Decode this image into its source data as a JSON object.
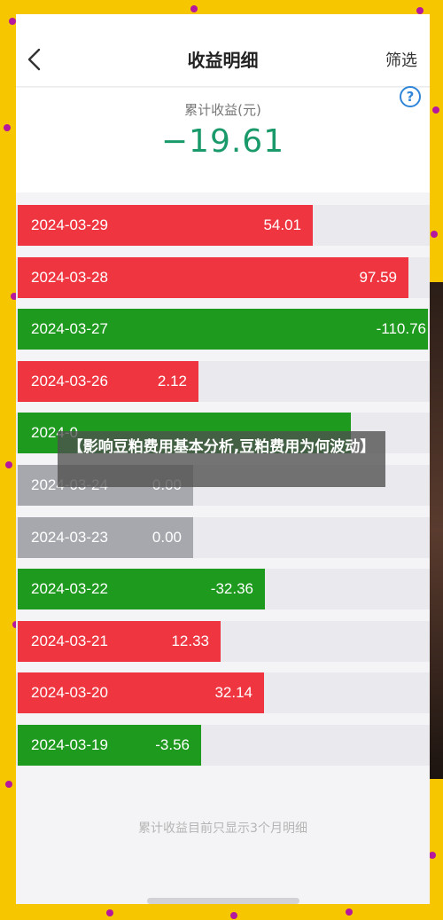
{
  "nav": {
    "title": "收益明细",
    "filter_label": "筛选"
  },
  "summary": {
    "label": "累计收益(元)",
    "value": "−19.61",
    "help_symbol": "?"
  },
  "colors": {
    "positive": "#ef3640",
    "negative": "#1e9a1e",
    "zero": "#a7a8ae",
    "summary_value": "#1a9a6a"
  },
  "rows": [
    {
      "date": "2024-03-29",
      "value": "54.01"
    },
    {
      "date": "2024-03-28",
      "value": "97.59"
    },
    {
      "date": "2024-03-27",
      "value": "-110.76"
    },
    {
      "date": "2024-03-26",
      "value": "2.12"
    },
    {
      "date": "2024-0",
      "value": ""
    },
    {
      "date": "2024-03-24",
      "value": "0.00"
    },
    {
      "date": "2024-03-23",
      "value": "0.00"
    },
    {
      "date": "2024-03-22",
      "value": "-32.36"
    },
    {
      "date": "2024-03-21",
      "value": "12.33"
    },
    {
      "date": "2024-03-20",
      "value": "32.14"
    },
    {
      "date": "2024-03-19",
      "value": "-3.56"
    }
  ],
  "footer_note": "累计收益目前只显示3个月明细",
  "caption": "【影响豆粕费用基本分析,豆粕费用为何波动】"
}
